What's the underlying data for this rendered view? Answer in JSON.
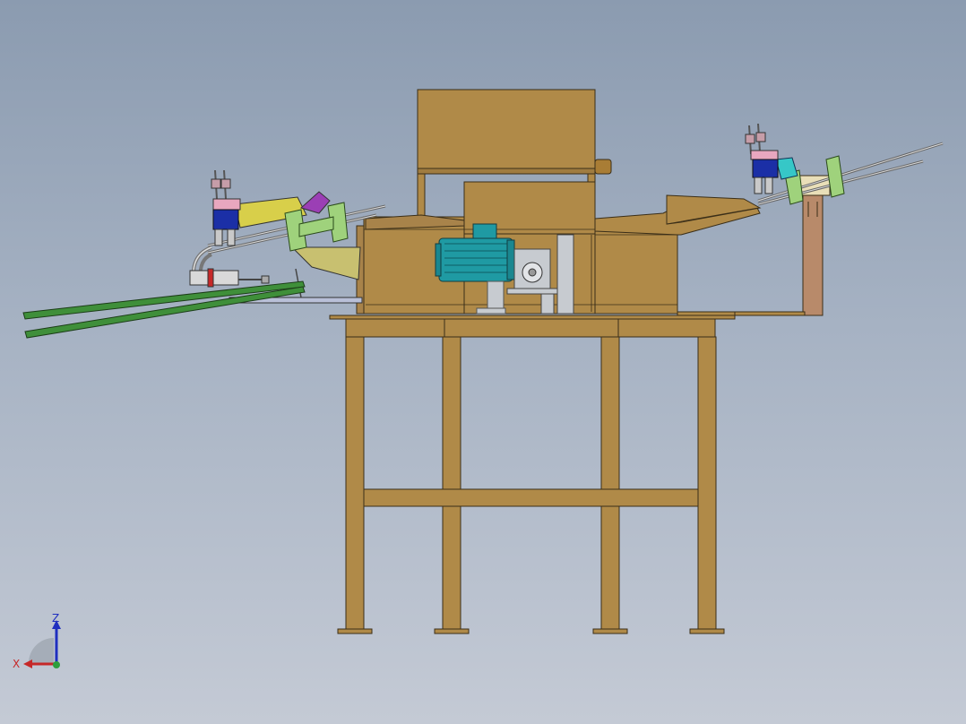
{
  "triad": {
    "z_label": "Z",
    "x_label": "X",
    "z_color": "#1f2fbf",
    "x_color": "#c62828",
    "y_color": "#2e9e3e"
  },
  "colors": {
    "frame": "#b08a48",
    "frame_stroke": "#3a2e18",
    "motor": "#1f9aa3",
    "gearbox": "#c7cbd0",
    "rails": "#3f8f3a",
    "yellow_plate": "#d8cf4a",
    "khaki_plate": "#c8c070",
    "cylinder_blue": "#1b2fa6",
    "bracket_green": "#9fd27c",
    "purple": "#9b3fb5",
    "cyan": "#36c7c7",
    "post": "#b88a6a"
  }
}
